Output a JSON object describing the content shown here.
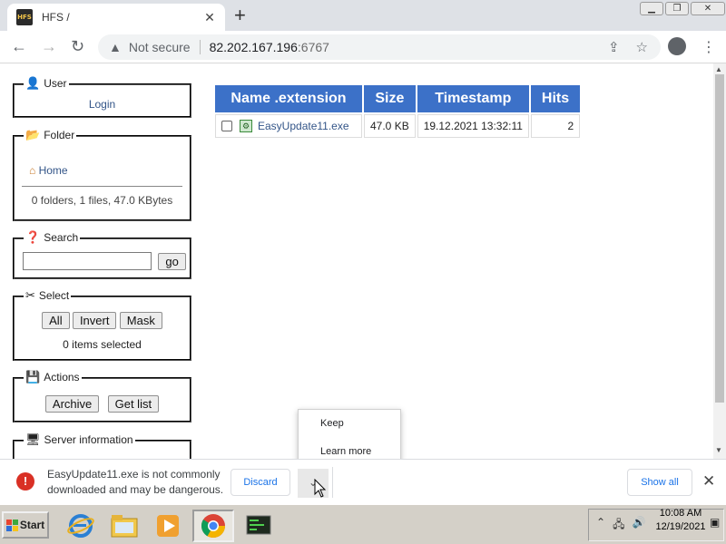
{
  "browser": {
    "tab_title": "HFS /",
    "tab_favicon_text": "HFS",
    "new_tab_label": "+",
    "security_label": "Not secure",
    "url_host": "82.202.167.196",
    "url_port": ":6767"
  },
  "sidebar": {
    "user": {
      "legend": "User",
      "login": "Login"
    },
    "folder": {
      "legend": "Folder",
      "home": "Home",
      "summary": "0 folders, 1 files, 47.0 KBytes"
    },
    "search": {
      "legend": "Search",
      "input_value": "",
      "go": "go"
    },
    "select": {
      "legend": "Select",
      "all": "All",
      "invert": "Invert",
      "mask": "Mask",
      "status": "0 items selected"
    },
    "actions": {
      "legend": "Actions",
      "archive": "Archive",
      "getlist": "Get list"
    },
    "server": {
      "legend": "Server information"
    }
  },
  "files": {
    "headers": [
      "Name .extension",
      "Size",
      "Timestamp",
      "Hits"
    ],
    "rows": [
      {
        "name": "EasyUpdate11.exe",
        "size": "47.0 KB",
        "timestamp": "19.12.2021 13:32:11",
        "hits": "2"
      }
    ]
  },
  "download_menu": {
    "keep": "Keep",
    "learn_more": "Learn more"
  },
  "download_bar": {
    "message": "EasyUpdate11.exe is not commonly downloaded and may be dangerous.",
    "discard": "Discard",
    "show_all": "Show all",
    "warning_glyph": "!"
  },
  "taskbar": {
    "start": "Start",
    "time": "10:08 AM",
    "date": "12/19/2021"
  },
  "colors": {
    "table_header": "#3c71c8",
    "link": "#335588",
    "danger": "#d93025",
    "accent_button_text": "#1a73e8"
  }
}
